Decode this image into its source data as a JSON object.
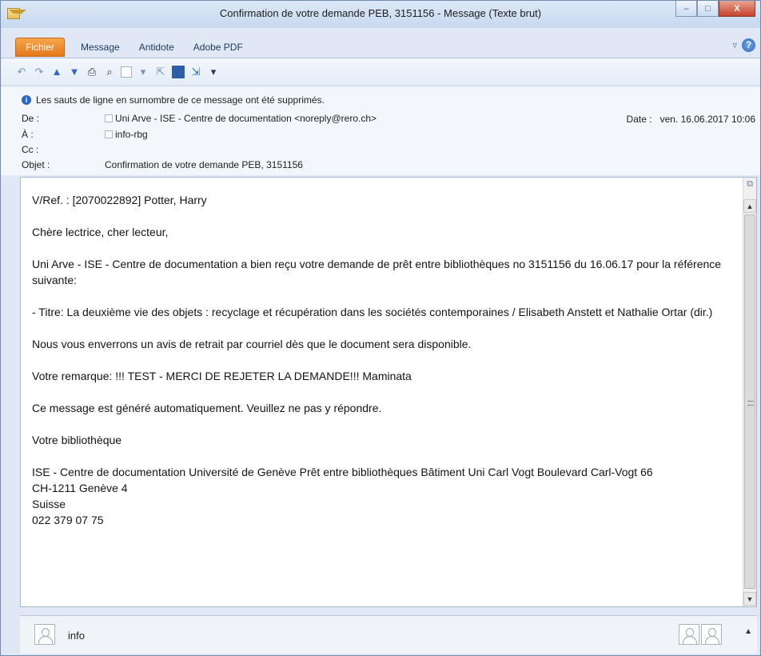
{
  "window": {
    "title": "Confirmation de votre demande PEB, 3151156  -  Message (Texte brut)",
    "buttons": {
      "minimize": "–",
      "maximize": "□",
      "close": "X"
    }
  },
  "ribbon": {
    "tabs": [
      "Fichier",
      "Message",
      "Antidote",
      "Adobe PDF"
    ],
    "help": "?"
  },
  "header": {
    "info": "Les sauts de ligne en surnombre de ce message ont été supprimés.",
    "from_label": "De :",
    "from_value": "Uni Arve - ISE - Centre de documentation <noreply@rero.ch>",
    "to_label": "À :",
    "to_value": "info-rbg",
    "cc_label": "Cc :",
    "subject_label": "Objet :",
    "subject_value": "Confirmation de votre demande PEB, 3151156",
    "date_label": "Date :",
    "date_value": "ven. 16.06.2017 10:06"
  },
  "message": {
    "ref": "V/Ref. : [2070022892] Potter, Harry",
    "greeting": "Chère lectrice, cher lecteur,",
    "p1": "Uni Arve - ISE - Centre de documentation a bien reçu votre demande de prêt entre bibliothèques no 3151156 du 16.06.17 pour la référence suivante:",
    "p2": "- Titre: La deuxième vie des objets : recyclage et récupération dans les sociétés contemporaines / Elisabeth Anstett et Nathalie Ortar (dir.)",
    "p3": "Nous vous enverrons un avis de retrait par courriel dès que le document sera disponible.",
    "p4": "Votre remarque: !!! TEST - MERCI DE REJETER LA DEMANDE!!! Maminata",
    "p5": "Ce message est généré automatiquement. Veuillez ne pas y répondre.",
    "p6": "Votre bibliothèque",
    "sig1": "ISE - Centre de documentation Université de Genève Prêt entre bibliothèques Bâtiment Uni Carl Vogt Boulevard Carl-Vogt 66",
    "sig2": "CH-1211 Genève 4",
    "sig3": "Suisse",
    "sig4": "022 379 07 75"
  },
  "people": {
    "name": "info"
  }
}
